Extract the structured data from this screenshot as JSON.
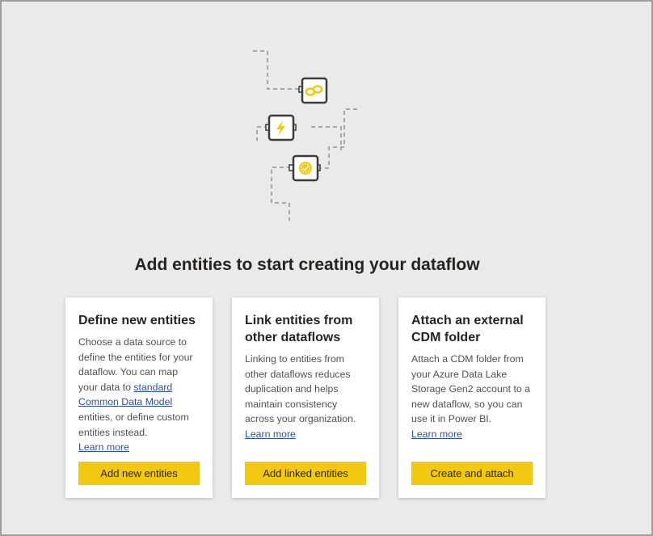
{
  "headline": "Add entities to start creating your dataflow",
  "cards": [
    {
      "title": "Define new entities",
      "body_before": "Choose a data source to define the entities for your dataflow. You can map your data to ",
      "body_link": "standard Common Data Model",
      "body_after": " entities, or define custom entities instead.",
      "learn_more": "Learn more",
      "button": "Add new entities"
    },
    {
      "title": "Link entities from other dataflows",
      "body": "Linking to entities from other dataflows reduces duplication and helps maintain consistency across your organization.",
      "learn_more": "Learn more",
      "button": "Add linked entities"
    },
    {
      "title": "Attach an external CDM folder",
      "body": "Attach a CDM folder from your Azure Data Lake Storage Gen2 account to a new dataflow, so you can use it in Power BI.",
      "learn_more": "Learn more",
      "button": "Create and attach"
    }
  ],
  "illustration": {
    "icons": [
      "link-icon",
      "lightning-icon",
      "badge-check-icon"
    ],
    "accent_color": "#f2c811",
    "line_color": "#a6a6a6"
  }
}
